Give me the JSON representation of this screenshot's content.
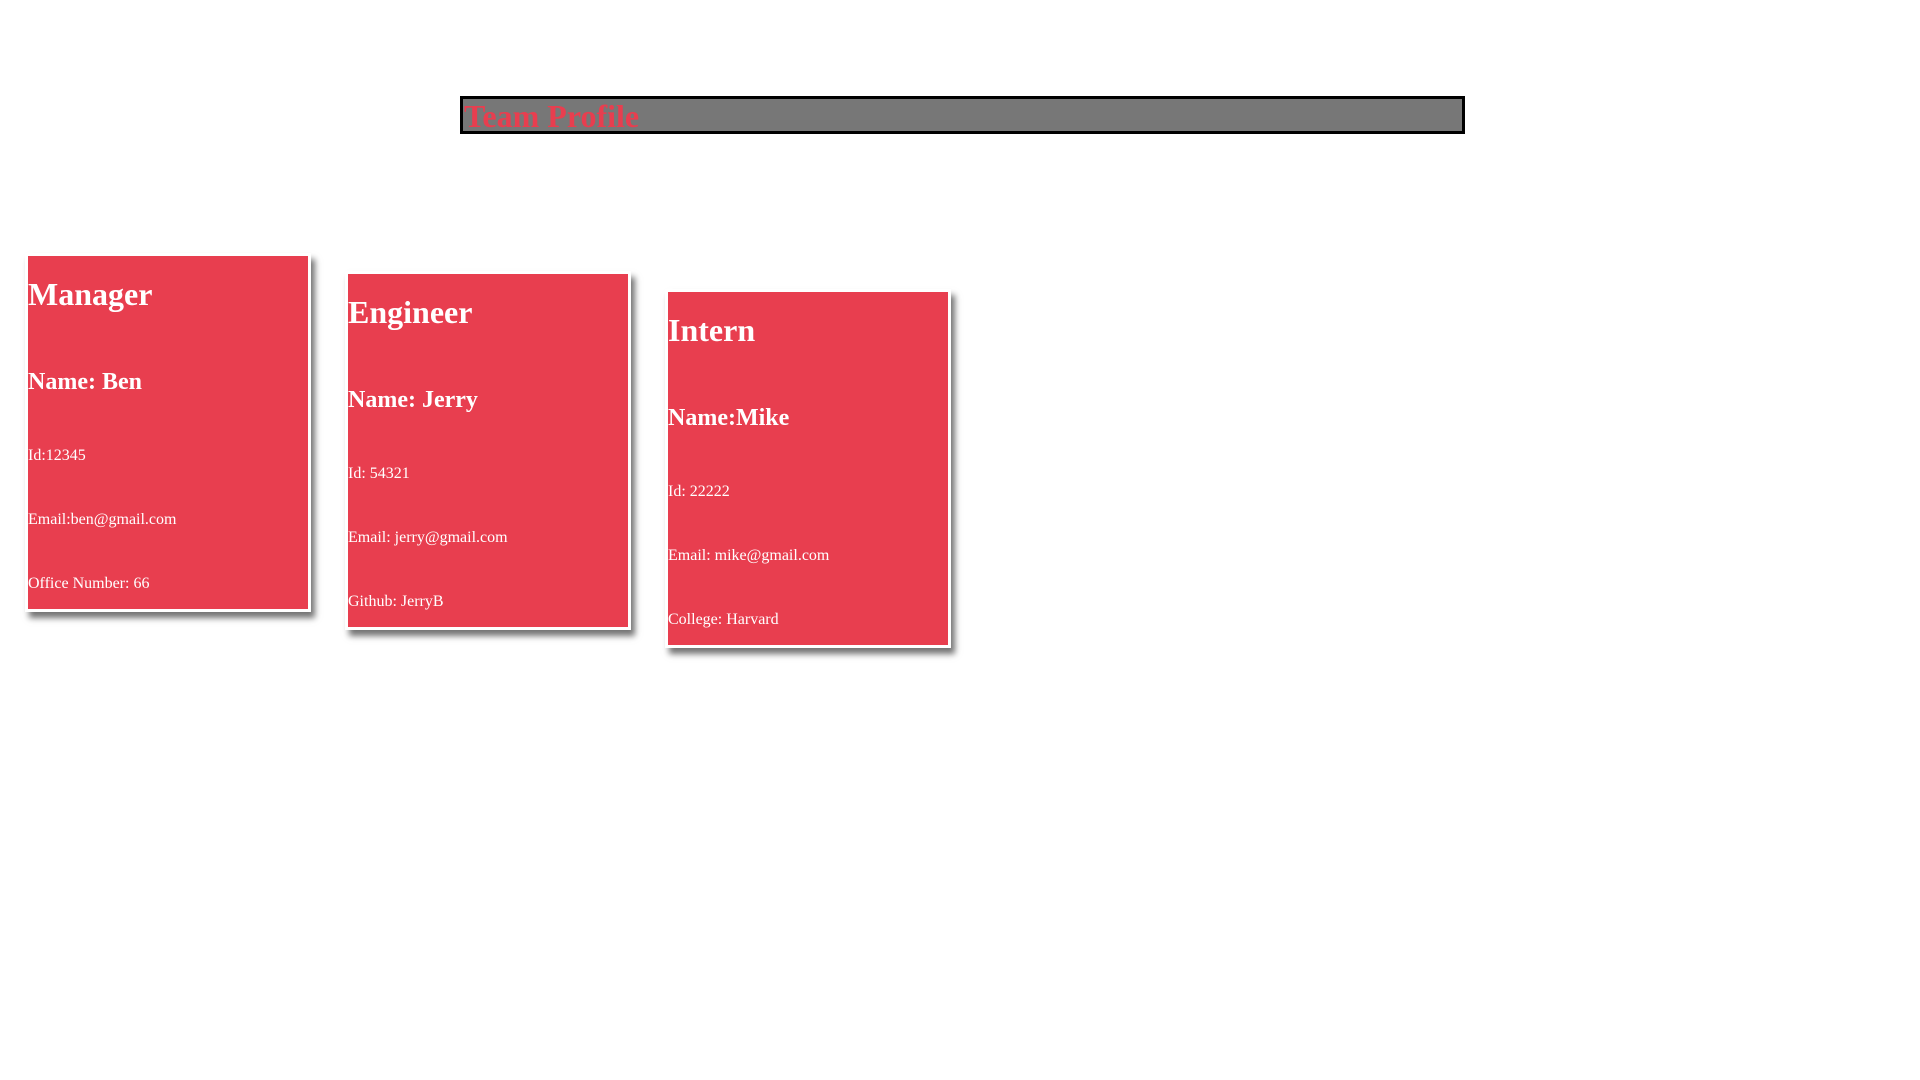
{
  "header": {
    "title": "Team Profile"
  },
  "colors": {
    "accent": "#e83e4f",
    "header_bg": "#777777",
    "header_border": "#000000",
    "card_text": "#ffffff"
  },
  "cards": [
    {
      "role": "Manager",
      "name": "Name: Ben",
      "line1": "Id:12345",
      "line2": "Email:ben@gmail.com",
      "line3": "Office Number: 66"
    },
    {
      "role": "Engineer",
      "name": "Name: Jerry",
      "line1": "Id: 54321",
      "line2": "Email: jerry@gmail.com",
      "line3": "Github: JerryB"
    },
    {
      "role": "Intern",
      "name": "Name:Mike",
      "line1": "Id: 22222",
      "line2": "Email: mike@gmail.com",
      "line3": "College: Harvard"
    }
  ]
}
